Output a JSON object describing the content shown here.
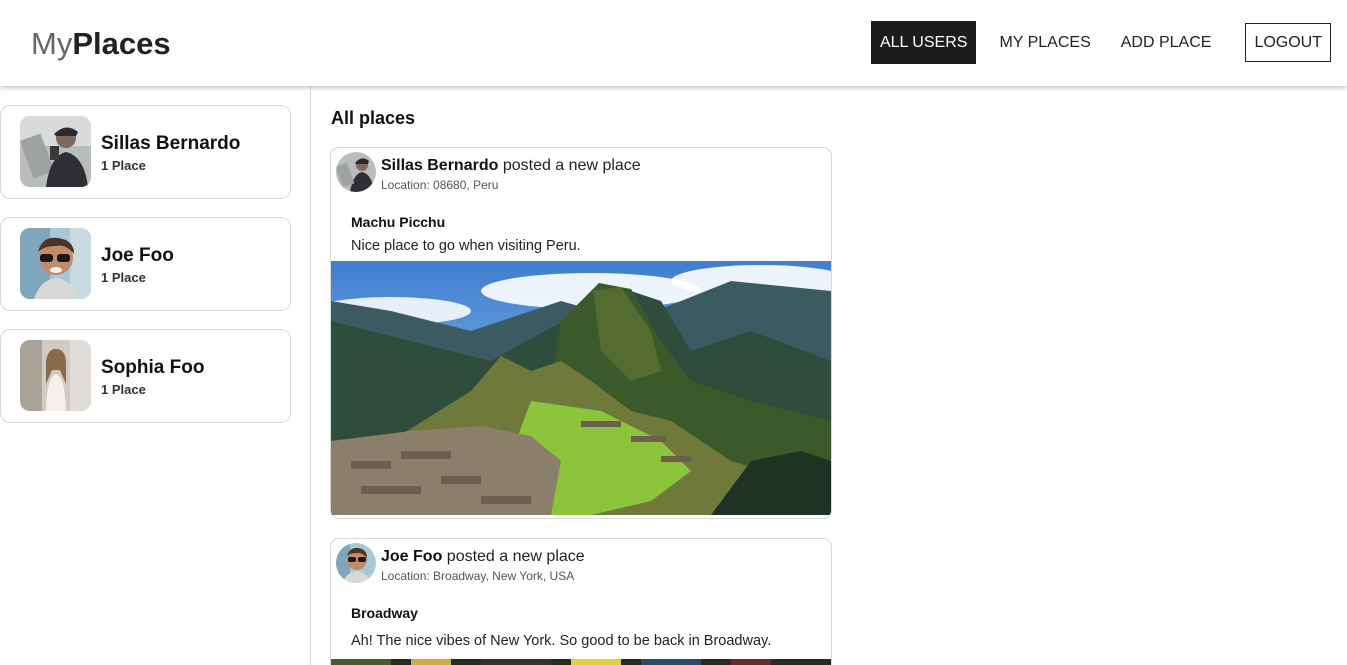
{
  "header": {
    "logo_light": "My",
    "logo_bold": "Places",
    "nav": {
      "all_users": "ALL USERS",
      "my_places": "MY PLACES",
      "add_place": "ADD PLACE",
      "logout": "LOGOUT"
    }
  },
  "sidebar": {
    "users": [
      {
        "name": "Sillas Bernardo",
        "places": "1 Place"
      },
      {
        "name": "Joe Foo",
        "places": "1 Place"
      },
      {
        "name": "Sophia Foo",
        "places": "1 Place"
      }
    ]
  },
  "main": {
    "title": "All places",
    "posts": [
      {
        "user": "Sillas Bernardo",
        "action": " posted a new place",
        "location": "Location: 08680, Peru",
        "title": "Machu Picchu",
        "description": "Nice place to go when visiting Peru."
      },
      {
        "user": "Joe Foo",
        "action": " posted a new place",
        "location": "Location: Broadway, New York, USA",
        "title": "Broadway",
        "description": "Ah! The nice vibes of New York. So good to be back in Broadway."
      }
    ]
  },
  "colors": {
    "active_nav_bg": "#1c1c1c",
    "card_border": "#d8d8d8"
  }
}
